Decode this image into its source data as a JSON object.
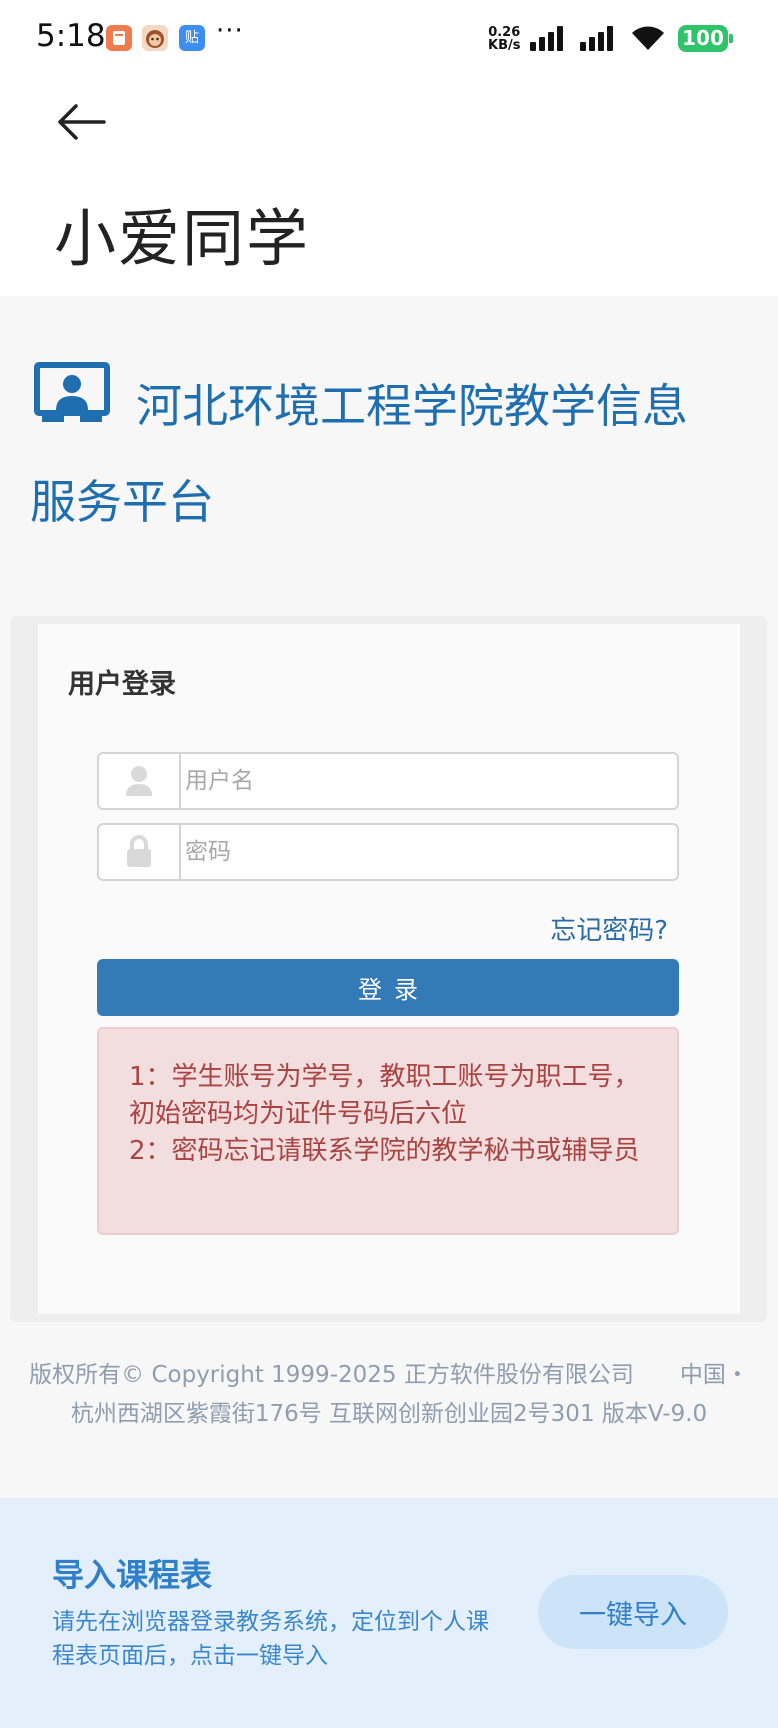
{
  "status_bar": {
    "time": "5:18",
    "app_icons": [
      {
        "icon": "notes-app-icon",
        "color": "#f07b4f"
      },
      {
        "icon": "monkey-app-icon",
        "color": "#f2d9c4"
      },
      {
        "icon": "tieba-app-icon",
        "color": "#3d8ef0",
        "glyph": "贴"
      }
    ],
    "more": "···",
    "net_speed_value": "0.26",
    "net_speed_unit": "KB/s",
    "battery": "100",
    "battery_color": "#2fc36a"
  },
  "app": {
    "title": "小爱同学"
  },
  "site": {
    "title_line1": "河北环境工程学院教学信息",
    "title_line2": "服务平台",
    "brand_color": "#1f6eb0"
  },
  "login": {
    "heading": "用户登录",
    "username_placeholder": "用户名",
    "password_placeholder": "密码",
    "forgot": "忘记密码?",
    "submit": "登录",
    "notice_lines": [
      "1：学生账号为学号，教职工账号为职工号，初始密码均为证件号码后六位",
      "2：密码忘记请联系学院的教学秘书或辅导员"
    ],
    "button_color": "#337ab7"
  },
  "footer": {
    "line1": "版权所有© Copyright 1999-2025 正方软件股份有限公司　　中国・",
    "line2": "杭州西湖区紫霞街176号 互联网创新创业园2号301 版本V-9.0"
  },
  "import": {
    "title": "导入课程表",
    "description": "请先在浏览器登录教务系统，定位到个人课程表页面后，点击一键导入",
    "button": "一键导入"
  }
}
